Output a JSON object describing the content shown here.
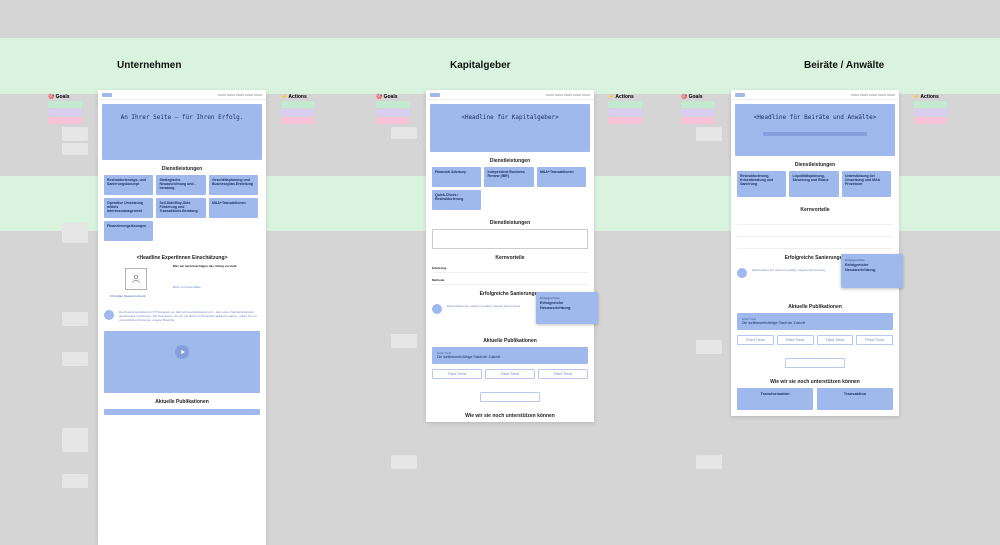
{
  "band_labels": {},
  "columns": {
    "unternehmen": {
      "title": "Unternehmen",
      "goals_head": "🎯 Goals",
      "actions_head": "⚡ Actions",
      "goals": [
        "",
        "",
        ""
      ],
      "actions": [
        "",
        "",
        ""
      ],
      "side_notes": [
        "",
        "",
        "",
        "",
        "",
        ""
      ],
      "page": {
        "hero_title": "An Ihrer Seite – für Ihren Erfolg.",
        "hero_sub": "",
        "section_services": "Dienstleistungen",
        "cards": [
          {
            "title": "Restrukturierungs- und Sanierungskonzept",
            "link": ""
          },
          {
            "title": "Strategische Neuausrichtung und -beratung",
            "link": ""
          },
          {
            "title": "Geschäftsplanung und Businessplan-Erstellung",
            "link": ""
          },
          {
            "title": "Operative Umsetzung mittels Interimsmanagement",
            "link": ""
          },
          {
            "title": "Sell-Side/Buy-Side Förderung und Transaktions-Beratung",
            "link": ""
          },
          {
            "title": "M&A+Transaktionen",
            "link": ""
          },
          {
            "title": "Finanzierungslösungen",
            "link": ""
          }
        ],
        "experts_headline": "<Headline ExpertInnen Einschätzung>",
        "expert_right_h": "Was wir berücksichtigen das richtig vorsteht",
        "expert_byline": "Christian Szewertscheck",
        "quote": "Die Zusammenarbeit mit FTI bedeutet vor Jahrzehnt auf jahrelang und – dazu einer Netzwerksphären gewachsenen vertrauen. Die Orientieren, die wir mit diesen Grundschritt gekämmt haben, macht uns zu unerschlichen Personen unserer Branche.",
        "section_pubs": "Aktuelle Publikationen"
      }
    },
    "kapitalgeber": {
      "title": "Kapitalgeber",
      "goals_head": "🎯 Goals",
      "actions_head": "⚡ Actions",
      "page": {
        "hero_title": "<Headline für Kapitalgeber>",
        "hero_sub": "",
        "section_services": "Dienstleistungen",
        "cards": [
          {
            "title": "Financial Advisory"
          },
          {
            "title": "Independent Business Review (IBR)"
          },
          {
            "title": "M&A+Transaktionen"
          },
          {
            "title": "Quick-Check / Restrukturierung"
          }
        ],
        "section_services2": "Dienstleistungen",
        "section_core": "Kernvorteile",
        "rows": [
          {
            "lab": "Erfahrung"
          },
          {
            "lab": "Methode"
          },
          {
            "lab": ""
          }
        ],
        "section_ref": "Erfolgreiche Sanierungen",
        "quote": "Partnerships are rooted in quality, integrity and honesty.",
        "float_title": "Erfolgreiche Neuausrichtung",
        "section_pubs": "Aktuelle Publikationen",
        "pub_card": "Die wettbewerbsfähige Stadt der Zukunft",
        "btns": [
          "Fixed Trend",
          "Fixed Trend",
          "Fixed Trend"
        ],
        "section_support": "Wie wir sie noch unterstützen können"
      }
    },
    "beiraete": {
      "title": "Beiräte / Anwälte",
      "goals_head": "🎯 Goals",
      "actions_head": "⚡ Actions",
      "page": {
        "hero_title": "<Headline für Beiräte und Anwälte>",
        "hero_sub": "",
        "section_services": "Dienstleistungen",
        "cards": [
          {
            "title": "Restrukturierung, Krisenberatung und Sanierung"
          },
          {
            "title": "Liquiditätsplanung, Steuerung und Bilanz"
          },
          {
            "title": "Unterstützung bei Umsetzung und M&A Prozessen"
          }
        ],
        "section_core": "Kernvorteile",
        "section_ref": "Erfolgreiche Sanierungen",
        "float_title": "Erfolgreiche Neuausrichtung",
        "quote": "Partnerships are rooted in quality, integrity and honesty.",
        "section_pubs": "Aktuelle Publikationen",
        "pub_card": "Die wettbewerbsfähige Stadt der Zukunft",
        "btns": [
          "Fixed Trend",
          "Fixed Trend",
          "Fixed Trend",
          "Fixed Trend"
        ],
        "section_support": "Wie wir sie noch unterstützen können",
        "support_cards": [
          "Transformation",
          "Transaktion"
        ]
      }
    }
  }
}
